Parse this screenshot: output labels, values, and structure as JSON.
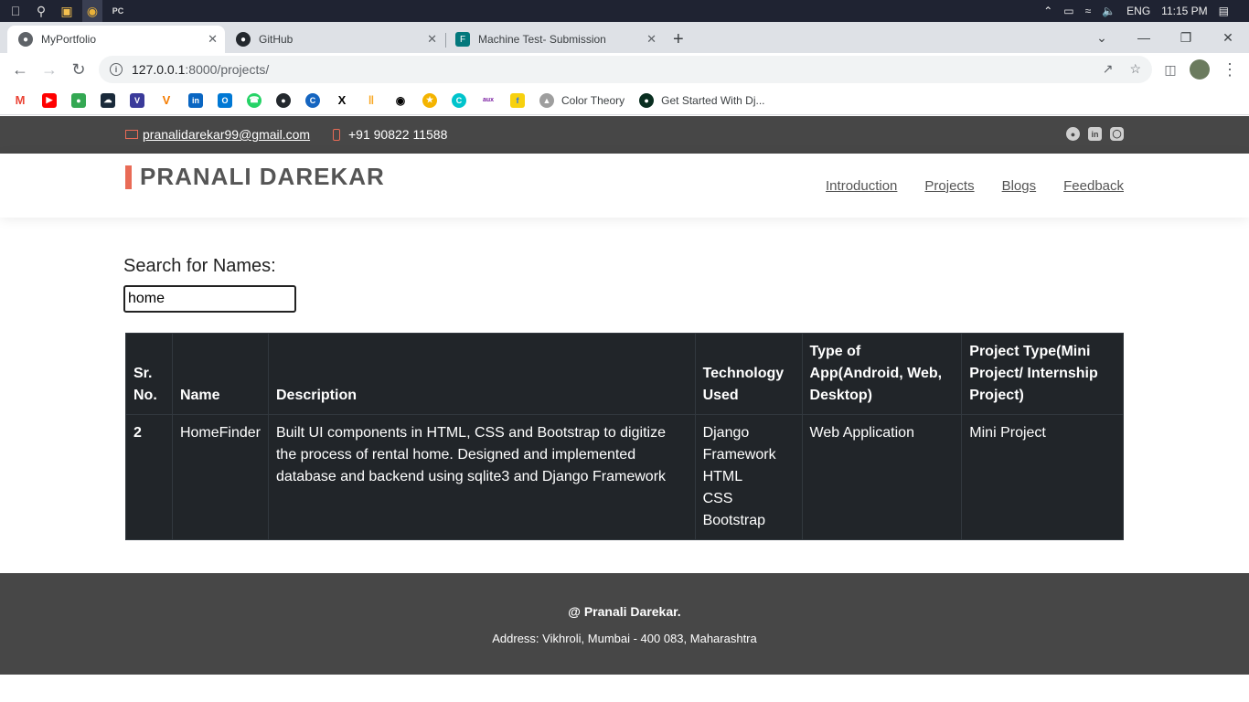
{
  "os": {
    "lang": "ENG",
    "time": "11:15 PM"
  },
  "tabs": [
    {
      "title": "MyPortfolio"
    },
    {
      "title": "GitHub"
    },
    {
      "title": "Machine Test- Submission"
    }
  ],
  "address": {
    "host": "127.0.0.1",
    "path": ":8000/projects/"
  },
  "bookmarks": {
    "color_theory": "Color Theory",
    "django": "Get Started With Dj..."
  },
  "site": {
    "email": "pranalidarekar99@gmail.com",
    "phone": "+91 90822 11588",
    "logo": "PRANALI DAREKAR",
    "nav": [
      "Introduction",
      "Projects",
      "Blogs",
      "Feedback"
    ],
    "accent": "#e96b56"
  },
  "search": {
    "label": "Search for Names:",
    "value": "home"
  },
  "table": {
    "headers": {
      "sr": "Sr. No.",
      "name": "Name",
      "desc": "Description",
      "tech": "Technology Used",
      "type": "Type of App(Android, Web, Desktop)",
      "ptype": "Project Type(Mini Project/ Internship Project)"
    },
    "rows": [
      {
        "sr": "2",
        "name": "HomeFinder",
        "desc": "Built UI components in HTML, CSS and Bootstrap to digitize the process of rental home. Designed and implemented database and backend using sqlite3 and Django Framework",
        "tech": [
          "Django Framework",
          "HTML",
          "CSS",
          "Bootstrap"
        ],
        "type": "Web Application",
        "ptype": "Mini Project"
      }
    ]
  },
  "footer": {
    "copy": "@ Pranali Darekar.",
    "address": "Address: Vikhroli, Mumbai - 400 083, Maharashtra"
  }
}
